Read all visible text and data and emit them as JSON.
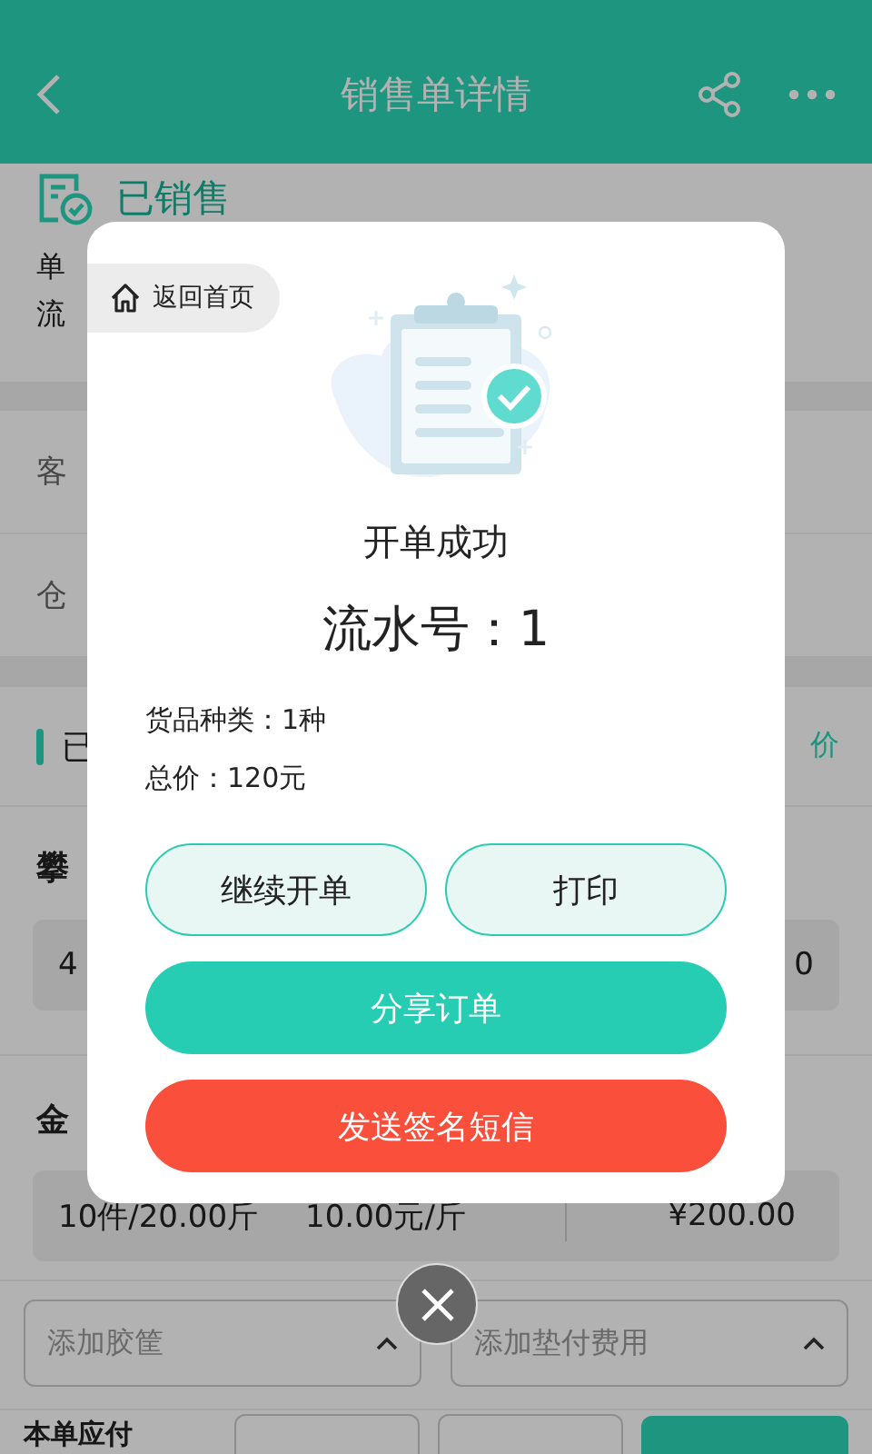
{
  "header": {
    "title": "销售单详情"
  },
  "order": {
    "status": "已销售",
    "order_no_label": "单",
    "serial_label": "流"
  },
  "fields": [
    {
      "label": "客"
    },
    {
      "label": "仓"
    }
  ],
  "goods_section": {
    "title": "已",
    "action": "价"
  },
  "items": [
    {
      "name": "攀",
      "cells": [
        "4",
        "0"
      ]
    },
    {
      "name": "金",
      "cells": [
        "10件/20.00斤",
        "10.00元/斤",
        "¥200.00"
      ]
    }
  ],
  "dropdowns": [
    {
      "placeholder": "添加胶筐"
    },
    {
      "placeholder": "添加垫付费用"
    }
  ],
  "footer": {
    "label": "本单应付"
  },
  "dialog": {
    "home_button": "返回首页",
    "title": "开单成功",
    "serial": "流水号：1",
    "details": [
      "货品种类：1种",
      "总价：120元"
    ],
    "buttons": [
      {
        "label": "继续开单",
        "kind": "outline"
      },
      {
        "label": "打印",
        "kind": "outline"
      },
      {
        "label": "分享订单",
        "kind": "primary"
      },
      {
        "label": "发送签名短信",
        "kind": "danger"
      }
    ]
  }
}
